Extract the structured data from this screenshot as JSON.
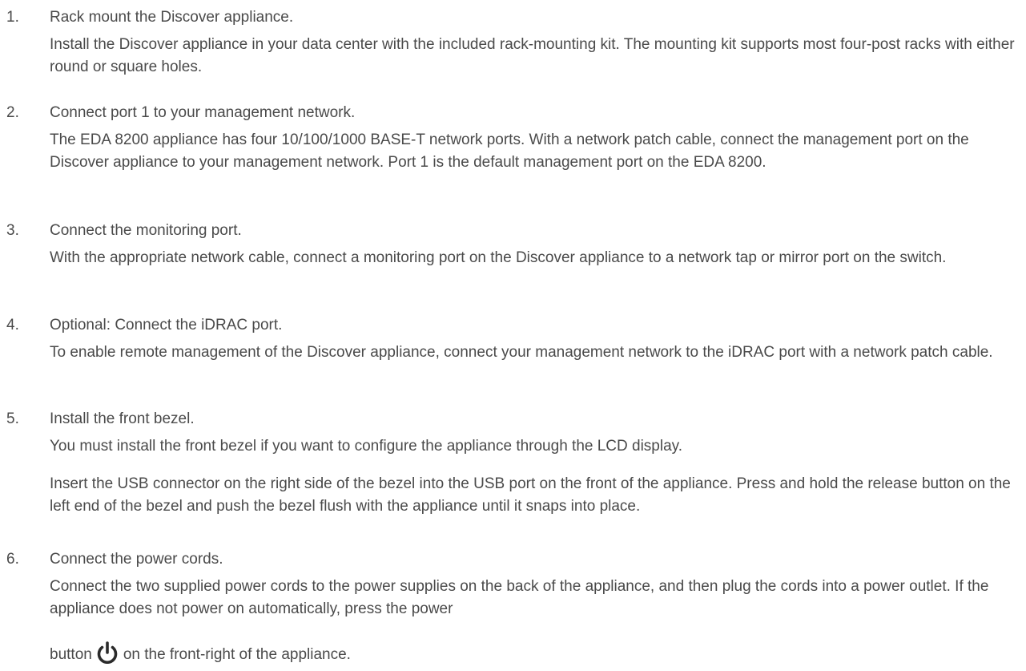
{
  "steps": [
    {
      "number": "1.",
      "title": "Rack mount the Discover appliance.",
      "paragraphs": [
        "Install the Discover appliance in your data center with the included rack-mounting kit. The mounting kit supports most four-post racks with either round or square holes."
      ]
    },
    {
      "number": "2.",
      "title": "Connect port 1 to your management network.",
      "paragraphs": [
        "The EDA 8200 appliance has four 10/100/1000 BASE-T network ports. With a network patch cable, connect the management port on the Discover appliance to your management network. Port 1 is the default management port on the EDA 8200."
      ]
    },
    {
      "number": "3.",
      "title": "Connect the monitoring port.",
      "paragraphs": [
        "With the appropriate network cable, connect a monitoring port on the Discover appliance to a network tap or mirror port on the switch."
      ]
    },
    {
      "number": "4.",
      "title": "Optional: Connect the iDRAC port.",
      "paragraphs": [
        "To enable remote management of the Discover appliance, connect your management network to the iDRAC port with a network patch cable."
      ]
    },
    {
      "number": "5.",
      "title": "Install the front bezel.",
      "paragraphs": [
        "You must install the front bezel if you want to configure the appliance through the LCD display.",
        "Insert the USB connector on the right side of the bezel into the USB port on the front of the appliance. Press and hold the release button on the left end of the bezel and push the bezel flush with the appliance until it snaps into place."
      ]
    },
    {
      "number": "6.",
      "title": "Connect the power cords.",
      "paragraphs": [
        "Connect the two supplied power cords to the power supplies on the back of the appliance, and then plug the cords into a power outlet. If the appliance does not power on automatically, press the power"
      ],
      "tail_before_icon": "button",
      "icon": "power-icon",
      "tail_after_icon": "on the front-right of the appliance."
    }
  ]
}
